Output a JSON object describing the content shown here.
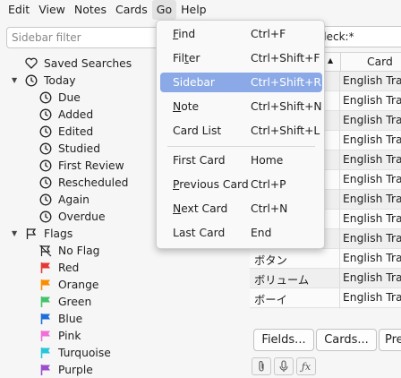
{
  "menubar": {
    "items": [
      "Edit",
      "View",
      "Notes",
      "Cards",
      "Go",
      "Help"
    ],
    "open": "Go"
  },
  "sidebar": {
    "filter_placeholder": "Sidebar filter",
    "saved_searches": "Saved Searches",
    "today": {
      "label": "Today",
      "children": [
        "Due",
        "Added",
        "Edited",
        "Studied",
        "First Review",
        "Rescheduled",
        "Again",
        "Overdue"
      ]
    },
    "flags": {
      "label": "Flags",
      "children": [
        {
          "label": "No Flag",
          "color": "#000000"
        },
        {
          "label": "Red",
          "color": "#e53935"
        },
        {
          "label": "Orange",
          "color": "#fb8c00"
        },
        {
          "label": "Green",
          "color": "#43c36a"
        },
        {
          "label": "Blue",
          "color": "#1e6fd8"
        },
        {
          "label": "Pink",
          "color": "#f06ed6"
        },
        {
          "label": "Turquoise",
          "color": "#26c6da"
        },
        {
          "label": "Purple",
          "color": "#9c4dcc"
        }
      ]
    }
  },
  "search": {
    "value": "deck:*"
  },
  "table": {
    "column_card": "Card",
    "rows": [
      {
        "q": "",
        "card": "English Tran"
      },
      {
        "q": "",
        "card": "English Tran"
      },
      {
        "q": "",
        "card": "English Tran"
      },
      {
        "q": "",
        "card": "English Tran"
      },
      {
        "q": "",
        "card": "English Tran"
      },
      {
        "q": "",
        "card": "English Tran"
      },
      {
        "q": "",
        "card": "English Tran"
      },
      {
        "q": "",
        "card": "English Tran"
      },
      {
        "q": "",
        "card": "English Tran"
      },
      {
        "q": "ボタン",
        "card": "English Tran"
      },
      {
        "q": "ボリューム",
        "card": "English Tran"
      },
      {
        "q": "ボーイ",
        "card": "English Tran"
      }
    ]
  },
  "editor": {
    "buttons": [
      "Fields...",
      "Cards...",
      "Pre"
    ]
  },
  "go_menu": {
    "items": [
      {
        "label": "Find",
        "underline": "F",
        "shortcut": "Ctrl+F"
      },
      {
        "label": "Filter",
        "underline": "t",
        "shortcut": "Ctrl+Shift+F"
      },
      {
        "label": "Sidebar",
        "underline": "",
        "shortcut": "Ctrl+Shift+R",
        "selected": true
      },
      {
        "label": "Note",
        "underline": "N",
        "shortcut": "Ctrl+Shift+N"
      },
      {
        "label": "Card List",
        "underline": "",
        "shortcut": "Ctrl+Shift+L"
      },
      {
        "label": "First Card",
        "underline": "",
        "shortcut": "Home"
      },
      {
        "label": "Previous Card",
        "underline": "P",
        "shortcut": "Ctrl+P"
      },
      {
        "label": "Next Card",
        "underline": "N",
        "shortcut": "Ctrl+N"
      },
      {
        "label": "Last Card",
        "underline": "",
        "shortcut": "End"
      }
    ]
  }
}
